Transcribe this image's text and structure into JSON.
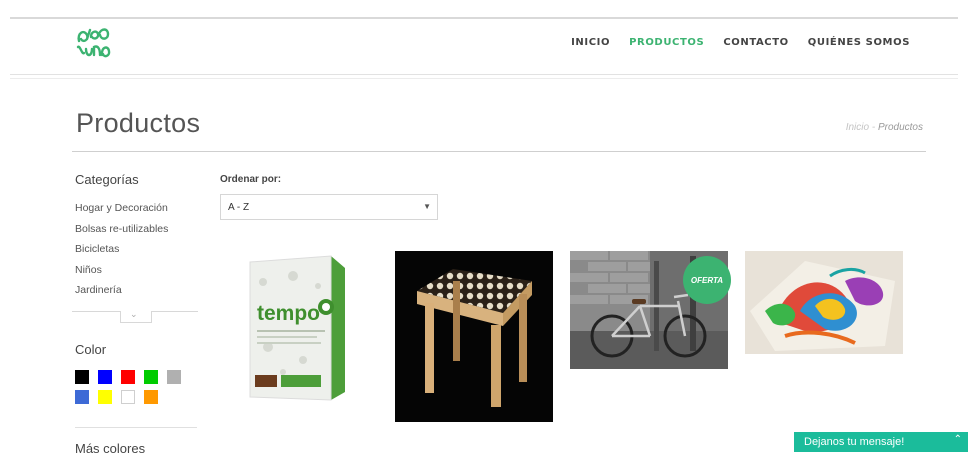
{
  "nav": {
    "items": [
      {
        "label": "INICIO",
        "active": false
      },
      {
        "label": "PRODUCTOS",
        "active": true
      },
      {
        "label": "CONTACTO",
        "active": false
      },
      {
        "label": "QUIÉNES SOMOS",
        "active": false
      }
    ]
  },
  "page": {
    "title": "Productos",
    "breadcrumb": {
      "home": "Inicio",
      "separator": "-",
      "current": "Productos"
    }
  },
  "sidebar": {
    "categories_heading": "Categorías",
    "categories": [
      "Hogar y Decoración",
      "Bolsas re-utilizables",
      "Bicicletas",
      "Niños",
      "Jardinería"
    ],
    "color_heading": "Color",
    "colors": [
      "#000000",
      "#0000ff",
      "#ff0000",
      "#00cc00",
      "#b0b0b0",
      "#3d6ad6",
      "#ffff00",
      "#ffffff",
      "#ff9900"
    ],
    "more_colors_heading": "Más colores"
  },
  "sort": {
    "label": "Ordenar por:",
    "value": "A - Z"
  },
  "products": [
    {
      "image": "paper-pack",
      "badge": ""
    },
    {
      "image": "stool",
      "badge": ""
    },
    {
      "image": "bicycle",
      "badge": "OFERTA"
    },
    {
      "image": "colorful-art",
      "badge": ""
    }
  ],
  "brand": {
    "accent": "#3cb371",
    "chat_color": "#1bbc9b"
  },
  "chat": {
    "label": "Dejanos tu mensaje!"
  }
}
